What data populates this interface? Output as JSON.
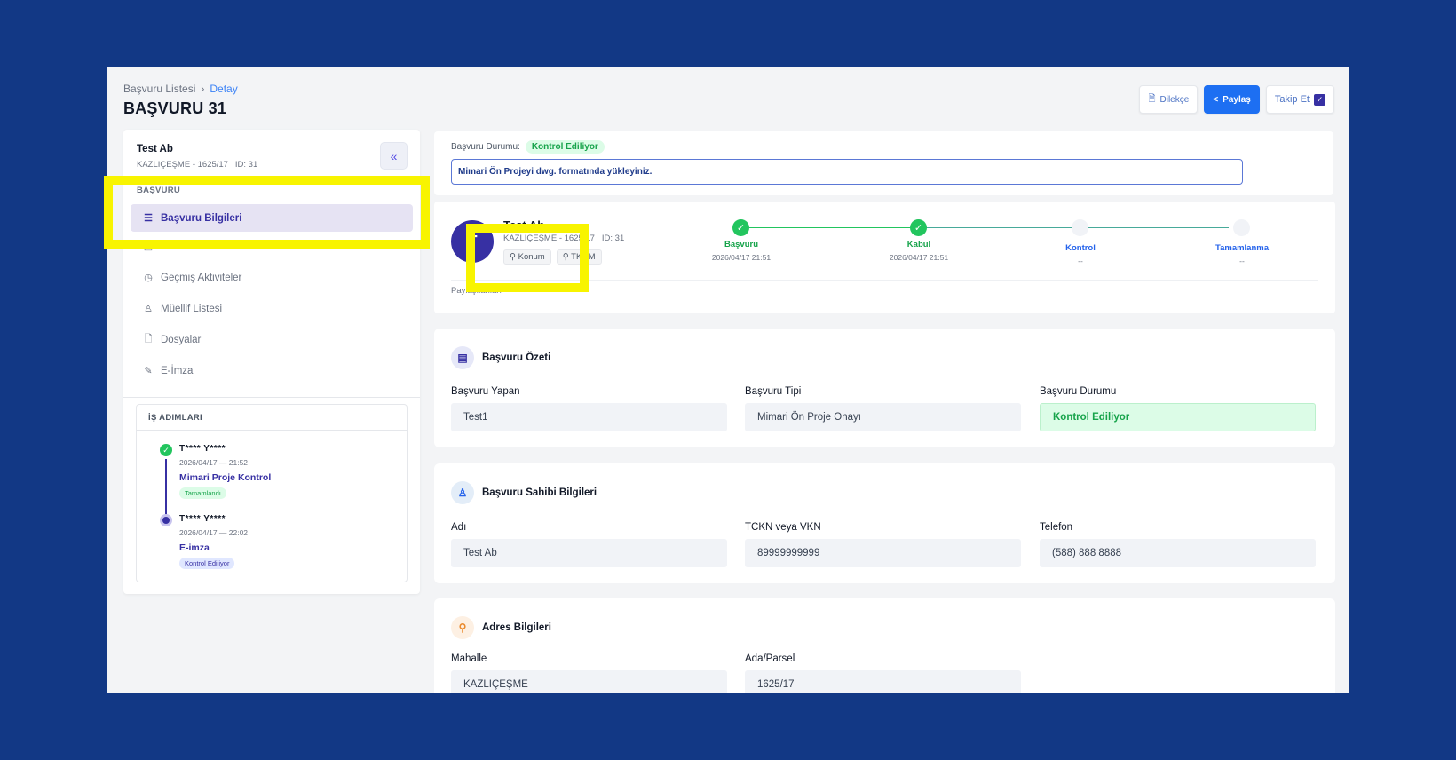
{
  "breadcrumb": {
    "parent": "Başvuru Listesi",
    "separator": "›",
    "current": "Detay"
  },
  "page_title": "BAŞVURU 31",
  "actions": {
    "dilekce": "Dilekçe",
    "paylas": "Paylaş",
    "takip": "Takip Et"
  },
  "sidebar": {
    "user_name": "Test Ab",
    "user_meta": "KAZLIÇEŞME - 1625/17   ID: 31",
    "section": "BAŞVURU",
    "items": [
      {
        "label": "Başvuru Bilgileri",
        "icon": "list-icon"
      },
      {
        "label": "",
        "icon": "form-icon"
      },
      {
        "label": "Geçmiş Aktiviteler",
        "icon": "clock-icon"
      },
      {
        "label": "Müellif Listesi",
        "icon": "user-icon"
      },
      {
        "label": "Dosyalar",
        "icon": "file-icon"
      },
      {
        "label": "E-İmza",
        "icon": "pen-icon"
      }
    ],
    "steps_title": "İŞ ADIMLARI",
    "steps": [
      {
        "name": "T**** Y****",
        "time": "2026/04/17 — 21:52",
        "task": "Mimari Proje Kontrol",
        "status": "Tamamlandı"
      },
      {
        "name": "T**** Y****",
        "time": "2026/04/17 — 22:02",
        "task": "E-imza",
        "status": "Kontrol Ediliyor"
      }
    ]
  },
  "status": {
    "label": "Başvuru Durumu:",
    "badge": "Kontrol Ediliyor",
    "notice": "Mimari Ön Projeyi dwg. formatında yükleyiniz."
  },
  "timeline": {
    "avatar_letter": "T",
    "name": "Test Ab",
    "meta": "KAZLIÇEŞME - 1625/17   ID: 31",
    "tags": [
      "Konum",
      "TKGM"
    ],
    "stages": [
      {
        "label": "Başvuru",
        "date": "2026/04/17 21:51",
        "done": true
      },
      {
        "label": "Kabul",
        "date": "2026/04/17 21:51",
        "done": true
      },
      {
        "label": "Kontrol",
        "date": "--",
        "done": false
      },
      {
        "label": "Tamamlanma",
        "date": "--",
        "done": false
      }
    ],
    "shared_label": "Paylaşılanlar:"
  },
  "summary": {
    "title": "Başvuru Özeti",
    "fields": [
      {
        "label": "Başvuru Yapan",
        "value": "Test1"
      },
      {
        "label": "Başvuru Tipi",
        "value": "Mimari Ön Proje Onayı"
      },
      {
        "label": "Başvuru Durumu",
        "value": "Kontrol Ediliyor"
      }
    ]
  },
  "owner": {
    "title": "Başvuru Sahibi Bilgileri",
    "fields": [
      {
        "label": "Adı",
        "value": "Test Ab"
      },
      {
        "label": "TCKN veya VKN",
        "value": "89999999999"
      },
      {
        "label": "Telefon",
        "value": "(588) 888 8888"
      }
    ]
  },
  "address": {
    "title": "Adres Bilgileri",
    "fields": [
      {
        "label": "Mahalle",
        "value": "KAZLIÇEŞME"
      },
      {
        "label": "Ada/Parsel",
        "value": "1625/17"
      }
    ]
  },
  "colors": {
    "background": "#123885",
    "accent": "#3730a3",
    "primary_button": "#1d6ff2",
    "success": "#22c55e",
    "highlight": "#f8f400"
  }
}
